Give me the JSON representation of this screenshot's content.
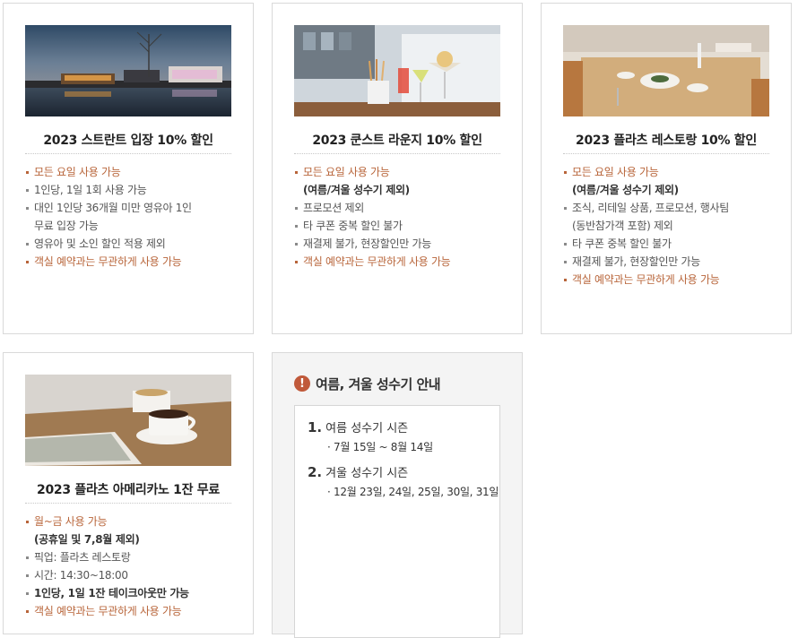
{
  "cards": [
    {
      "title": "2023 스트란트 입장 10% 할인",
      "image_alt": "night pool view",
      "items": [
        {
          "text": "모든 요일 사용 가능",
          "style": "orange"
        },
        {
          "text": "1인당, 1일 1회 사용 가능",
          "style": "gray"
        },
        {
          "text": "대인 1인당 36개월 미만 영유아 1인",
          "cont": "무료 입장 가능",
          "style": "gray"
        },
        {
          "text": "영유아 및 소인 할인 적용 제외",
          "style": "gray"
        },
        {
          "text": "객실 예약과는 무관하게 사용 가능",
          "style": "orange"
        }
      ]
    },
    {
      "title": "2023 쿤스트 라운지 10% 할인",
      "image_alt": "lounge drinks",
      "items": [
        {
          "text": "모든 요일 사용 가능",
          "style": "orange",
          "sub": "(여름/겨울 성수기 제외)"
        },
        {
          "text": "프로모션 제외",
          "style": "gray"
        },
        {
          "text": "타 쿠폰 중복 할인 불가",
          "style": "gray"
        },
        {
          "text": "재결제 불가, 현장할인만 가능",
          "style": "gray"
        },
        {
          "text": "객실 예약과는 무관하게 사용 가능",
          "style": "orange"
        }
      ]
    },
    {
      "title": "2023 플라츠 레스토랑 10% 할인",
      "image_alt": "restaurant table",
      "items": [
        {
          "text": "모든 요일 사용 가능",
          "style": "orange",
          "sub": "(여름/겨울 성수기 제외)"
        },
        {
          "text": "조식, 리테일 상품, 프로모션, 행사팀",
          "cont": "(동반참가객 포함) 제외",
          "style": "gray"
        },
        {
          "text": "타 쿠폰 중복 할인 불가",
          "style": "gray"
        },
        {
          "text": "재결제 불가, 현장할인만 가능",
          "style": "gray"
        },
        {
          "text": "객실 예약과는 무관하게 사용 가능",
          "style": "orange"
        }
      ]
    },
    {
      "title": "2023 플라츠 아메리카노 1잔 무료",
      "image_alt": "coffee cup",
      "items": [
        {
          "text": "월~금 사용 가능",
          "style": "orange",
          "sub": "(공휴일 및 7,8월 제외)"
        },
        {
          "text": "픽업: 플라츠 레스토랑",
          "style": "gray"
        },
        {
          "text": "시간: 14:30~18:00",
          "style": "gray"
        },
        {
          "text": "1인당, 1일 1잔 테이크아웃만 가능",
          "style": "bold"
        },
        {
          "text": "객실 예약과는 무관하게 사용 가능",
          "style": "orange"
        }
      ]
    }
  ],
  "notice": {
    "icon": "!",
    "title": "여름, 겨울 성수기 안내",
    "seasons": [
      {
        "num": "1.",
        "name": "여름 성수기 시즌",
        "dates": "· 7월 15일 ~ 8월 14일"
      },
      {
        "num": "2.",
        "name": "겨울 성수기 시즌",
        "dates": "· 12월 23일, 24일, 25일, 30일, 31일"
      }
    ]
  },
  "colors": {
    "accent": "#b8653a",
    "notice_icon": "#c0593a",
    "border": "#d9d9d9"
  }
}
